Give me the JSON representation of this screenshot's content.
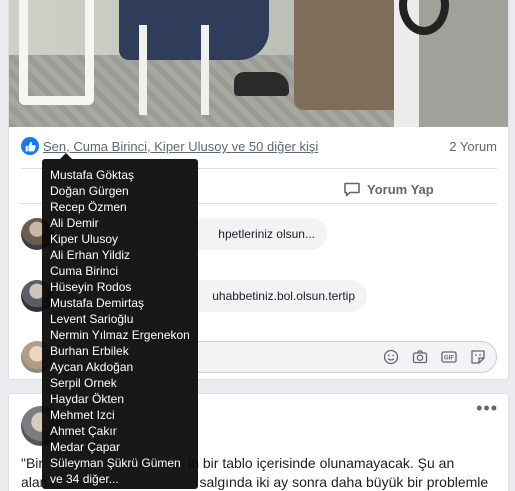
{
  "post1": {
    "likers_text": "Sen, Cuma Birinci, Kiper Ulusoy ve 50 diğer kişi",
    "comment_count": "2 Yorum",
    "comment_action": "Yorum Yap",
    "comments": [
      {
        "text": "hpetleriniz olsun..."
      },
      {
        "text": "uhabbetiniz.bol.olsun.tertip"
      }
    ],
    "write_tools": [
      "emoji-icon",
      "camera-icon",
      "gif-icon",
      "sticker-icon"
    ],
    "gif_label": "GIF"
  },
  "tooltip": {
    "names": [
      "Mustafa Göktaş",
      "Doğan Gürgen",
      "Recep Özmen",
      "Ali Demir",
      "Kiper Ulusoy",
      "Ali Erhan Yildiz",
      "Cuma Birinci",
      "Hüseyin Rodos",
      "Mustafa Demirtaş",
      "Levent Sarioğlu",
      "Nermin Yılmaz Ergenekon",
      "Burhan Erbilek",
      "Aycan Akdoğan",
      "Serpil Ornek",
      "Haydar Ökten",
      "Mehmet Izci",
      "Ahmet Çakır",
      "Medar Çapar",
      "Süleyman Şükrü Gümen",
      "ve 34 diğer..."
    ]
  },
  "post2": {
    "more_label": "•••",
    "line1_prefix": "\"Bir",
    "line1_suffix": "in bir tablo içerisinde olunamayacak. Şu an",
    "line2_prefix": "alan",
    "line2_suffix": "salgında iki ay sonra daha büyük bir problemle"
  },
  "colors": {
    "accent": "#1877f2",
    "tooltip_bg": "#0a0a0a"
  }
}
